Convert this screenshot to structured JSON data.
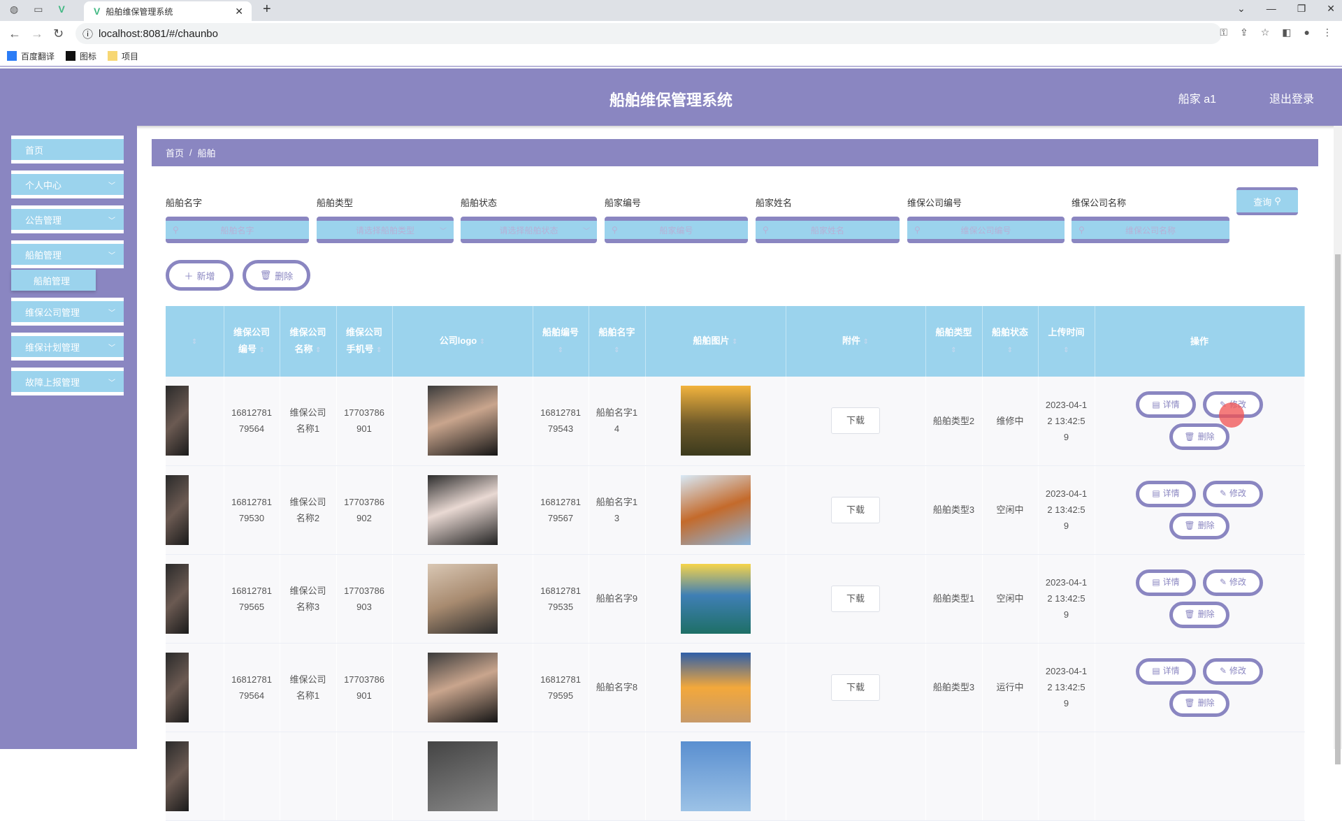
{
  "browser": {
    "tab_title": "船舶维保管理系统",
    "url": "localhost:8081/#/chaunbo",
    "bookmarks": [
      "百度翻译",
      "图标",
      "项目"
    ]
  },
  "header": {
    "title": "船舶维保管理系统",
    "user": "船家 a1",
    "logout": "退出登录"
  },
  "sidebar": {
    "items": [
      {
        "label": "首页"
      },
      {
        "label": "个人中心"
      },
      {
        "label": "公告管理"
      },
      {
        "label": "船舶管理"
      },
      {
        "label": "维保公司管理"
      },
      {
        "label": "维保计划管理"
      },
      {
        "label": "故障上报管理"
      }
    ],
    "sub_item": "船舶管理"
  },
  "breadcrumb": {
    "home": "首页",
    "sep": "/",
    "current": "船舶"
  },
  "search": {
    "fields": [
      {
        "label": "船舶名字",
        "placeholder": "船舶名字"
      },
      {
        "label": "船舶类型",
        "placeholder": "请选择船舶类型"
      },
      {
        "label": "船舶状态",
        "placeholder": "请选择船舶状态"
      },
      {
        "label": "船家编号",
        "placeholder": "船家编号"
      },
      {
        "label": "船家姓名",
        "placeholder": "船家姓名"
      },
      {
        "label": "维保公司编号",
        "placeholder": "维保公司编号"
      },
      {
        "label": "维保公司名称",
        "placeholder": "维保公司名称"
      }
    ],
    "query_label": "查询"
  },
  "actions": {
    "add": "新增",
    "delete": "删除"
  },
  "table": {
    "headers": [
      "",
      "维保公司编号",
      "维保公司名称",
      "维保公司手机号",
      "公司logo",
      "船舶编号",
      "船舶名字",
      "船舶图片",
      "附件",
      "船舶类型",
      "船舶状态",
      "上传时间",
      "操作"
    ],
    "download": "下载",
    "detail": "详情",
    "edit": "修改",
    "delete": "删除",
    "rows": [
      {
        "company_no": "1681278179564",
        "company_name": "维保公司名称1",
        "phone": "17703786901",
        "ship_no": "1681278179543",
        "ship_name": "船舶名字14",
        "ship_type": "船舶类型2",
        "status": "维修中",
        "time": "2023-04-12 13:42:59"
      },
      {
        "company_no": "1681278179530",
        "company_name": "维保公司名称2",
        "phone": "17703786902",
        "ship_no": "1681278179567",
        "ship_name": "船舶名字13",
        "ship_type": "船舶类型3",
        "status": "空闲中",
        "time": "2023-04-12 13:42:59"
      },
      {
        "company_no": "1681278179565",
        "company_name": "维保公司名称3",
        "phone": "17703786903",
        "ship_no": "1681278179535",
        "ship_name": "船舶名字9",
        "ship_type": "船舶类型1",
        "status": "空闲中",
        "time": "2023-04-12 13:42:59"
      },
      {
        "company_no": "1681278179564",
        "company_name": "维保公司名称1",
        "phone": "17703786901",
        "ship_no": "1681278179595",
        "ship_name": "船舶名字8",
        "ship_type": "船舶类型3",
        "status": "运行中",
        "time": "2023-04-12 13:42:59"
      }
    ]
  }
}
